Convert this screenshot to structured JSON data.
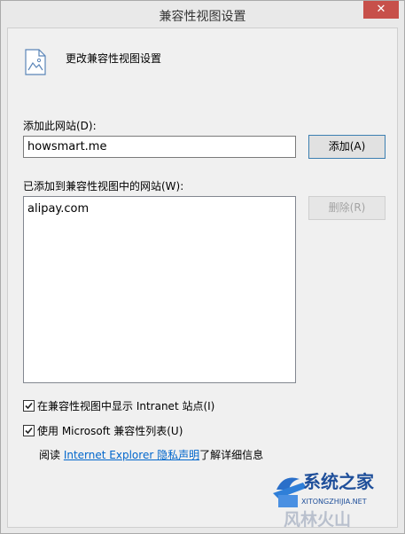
{
  "window": {
    "title": "兼容性视图设置",
    "close_label": "✕"
  },
  "header": {
    "text": "更改兼容性视图设置",
    "icon": "document-picture-icon"
  },
  "add_section": {
    "label": "添加此网站(D):",
    "input_value": "howsmart.me",
    "add_button": "添加(A)"
  },
  "list_section": {
    "label": "已添加到兼容性视图中的网站(W):",
    "items": [
      "alipay.com"
    ],
    "remove_button": "删除(R)"
  },
  "options": {
    "intranet": {
      "label": "在兼容性视图中显示 Intranet 站点(I)",
      "checked": true
    },
    "ms_list": {
      "label": "使用 Microsoft 兼容性列表(U)",
      "checked": true
    }
  },
  "privacy": {
    "prefix": "阅读 ",
    "link": "Internet Explorer 隐私声明",
    "suffix": "了解详细信息"
  },
  "watermark": {
    "brand": "系统之家",
    "url": "XITONGZHIJIA.NET",
    "sub": "风林火山"
  },
  "colors": {
    "close_button": "#c7504a",
    "link": "#0066cc",
    "primary_border": "#3c7fb1"
  }
}
